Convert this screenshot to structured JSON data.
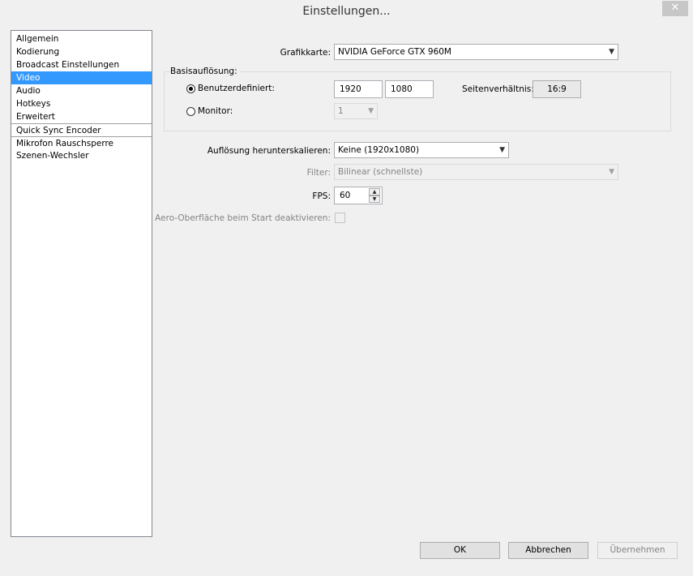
{
  "window": {
    "title": "Einstellungen...",
    "close_glyph": "✕"
  },
  "sidebar": {
    "items": [
      {
        "label": "Allgemein"
      },
      {
        "label": "Kodierung"
      },
      {
        "label": "Broadcast Einstellungen"
      },
      {
        "label": "Video"
      },
      {
        "label": "Audio"
      },
      {
        "label": "Hotkeys"
      },
      {
        "label": "Erweitert"
      },
      {
        "label": "Quick Sync Encoder"
      },
      {
        "label": "Mikrofon Rauschsperre"
      },
      {
        "label": "Szenen-Wechsler"
      }
    ],
    "selected": "Video"
  },
  "video": {
    "graphics_label": "Grafikkarte:",
    "graphics_value": "NVIDIA GeForce GTX 960M",
    "base_res_title": "Basisauflösung:",
    "custom_label": "Benutzerdefiniert:",
    "width_value": "1920",
    "height_value": "1080",
    "aspect_label": "Seitenverhältnis:",
    "aspect_value": "16:9",
    "monitor_label": "Monitor:",
    "monitor_value": "1",
    "downscale_label": "Auflösung herunterskalieren:",
    "downscale_value": "Keine  (1920x1080)",
    "filter_label": "Filter:",
    "filter_value": "Bilinear (schnellste)",
    "fps_label": "FPS:",
    "fps_value": "60",
    "aero_label": "Aero-Oberfläche beim Start deaktivieren:"
  },
  "buttons": {
    "ok": "OK",
    "cancel": "Abbrechen",
    "apply": "Übernehmen"
  },
  "icons": {
    "dropdown": "chevron-down-icon",
    "spin_up": "▲",
    "spin_down": "▼"
  }
}
